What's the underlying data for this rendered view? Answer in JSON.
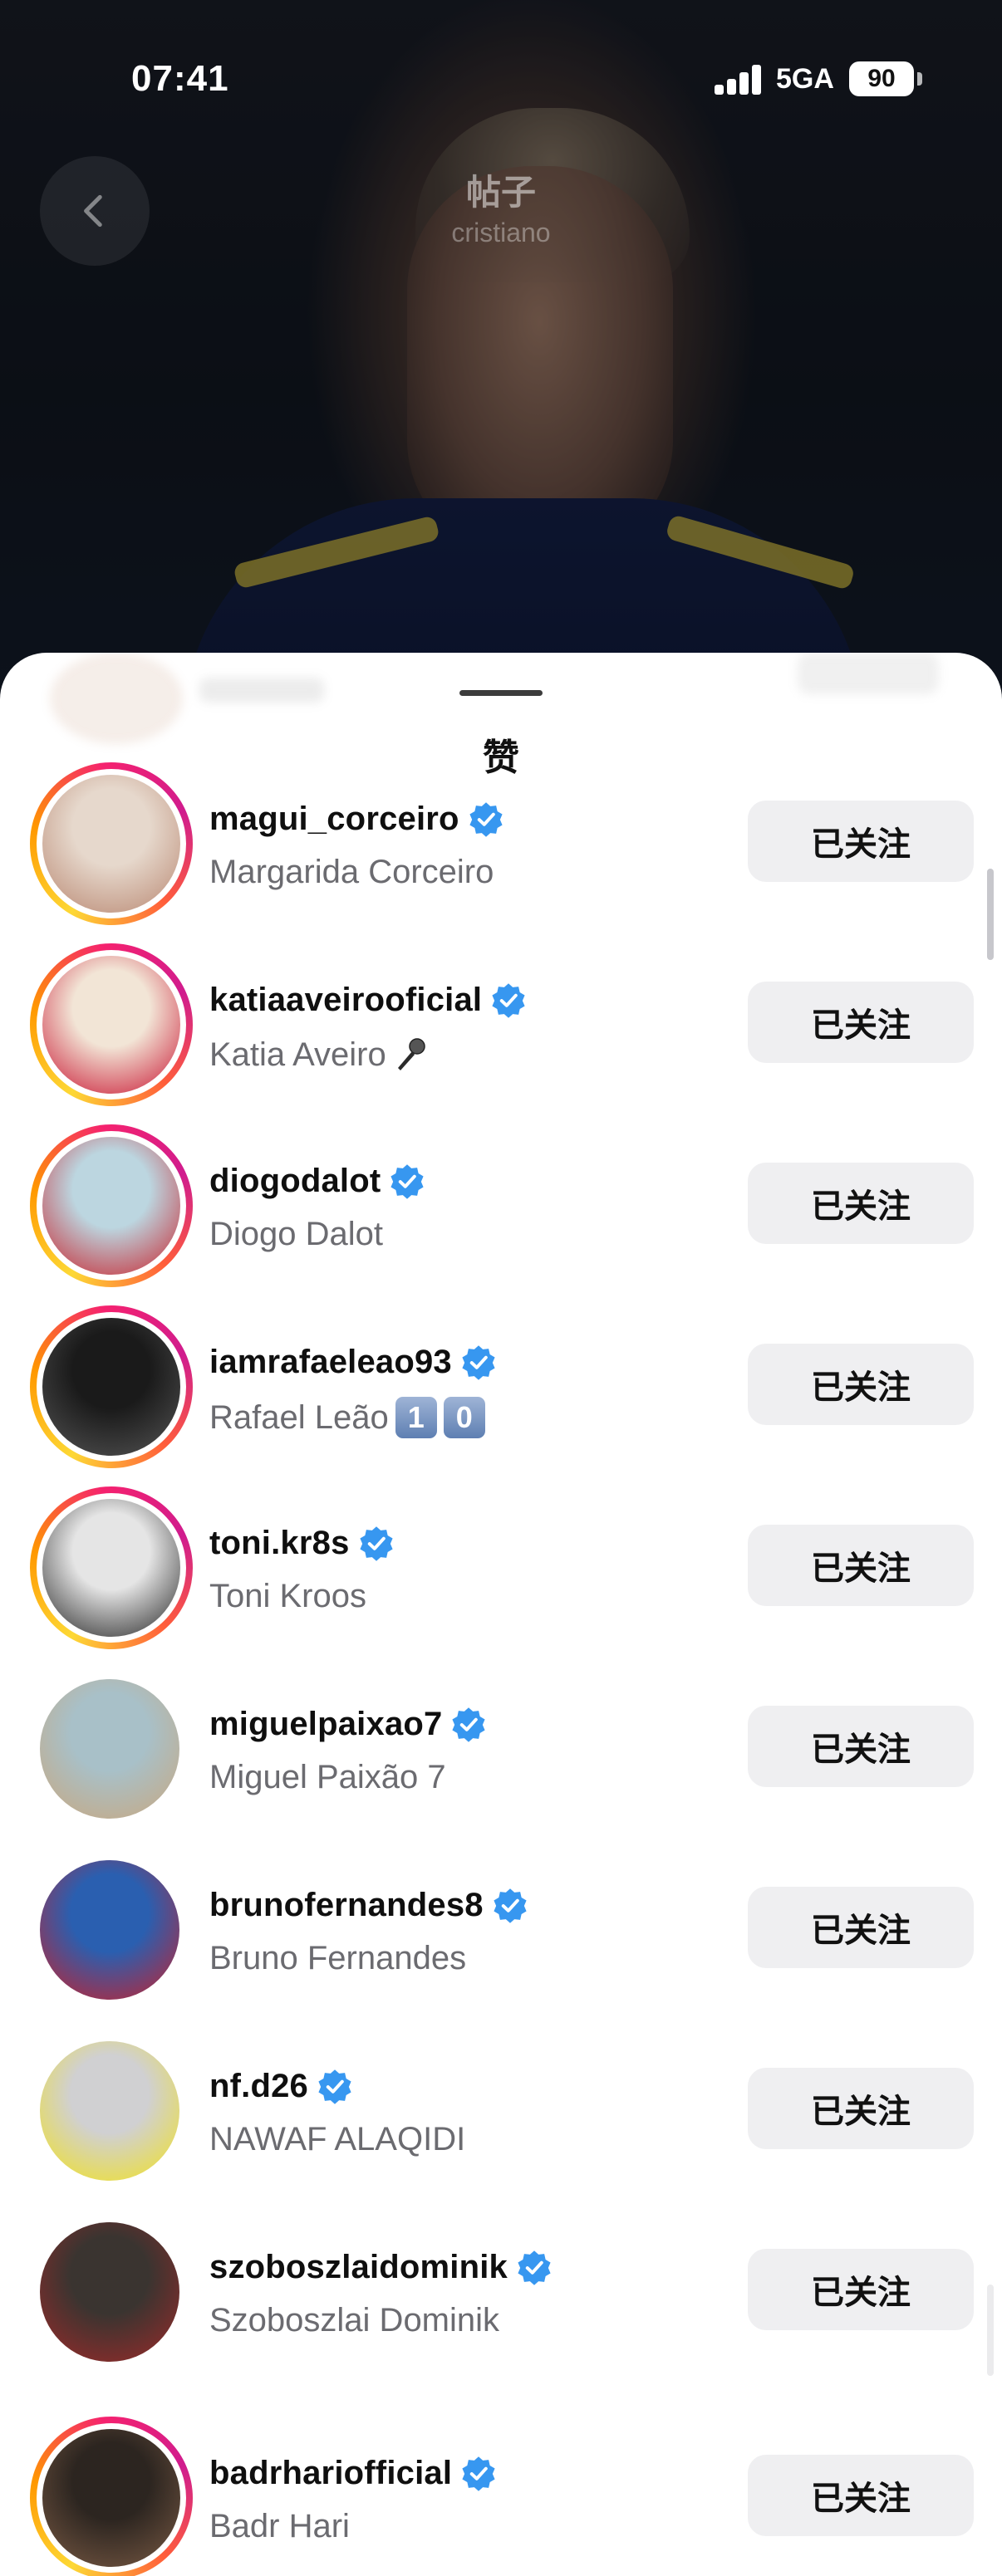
{
  "status_bar": {
    "time": "07:41",
    "network": "5GA",
    "battery": "90"
  },
  "header": {
    "title": "帖子",
    "subtitle": "cristiano"
  },
  "sheet": {
    "title": "赞"
  },
  "likes": [
    {
      "username": "magui_corceiro",
      "display_name": "Margarida Corceiro",
      "button": "已关注",
      "has_story": true,
      "avatar_colors": [
        "#e6d8cc",
        "#b88670"
      ]
    },
    {
      "username": "katiaaveirooficial",
      "display_name": "Katia Aveiro",
      "name_icon": "microphone-icon",
      "button": "已关注",
      "has_story": true,
      "avatar_colors": [
        "#f2e5d6",
        "#c8102e"
      ]
    },
    {
      "username": "diogodalot",
      "display_name": "Diogo Dalot",
      "button": "已关注",
      "has_story": true,
      "avatar_colors": [
        "#bcd6e0",
        "#c8202a"
      ]
    },
    {
      "username": "iamrafaeleao93",
      "display_name": "Rafael Leão",
      "name_keycaps": [
        "1",
        "0"
      ],
      "button": "已关注",
      "has_story": true,
      "avatar_colors": [
        "#1a1a1a",
        "#555555"
      ]
    },
    {
      "username": "toni.kr8s",
      "display_name": "Toni Kroos",
      "button": "已关注",
      "has_story": true,
      "avatar_colors": [
        "#e5e5e5",
        "#222222"
      ]
    },
    {
      "username": "miguelpaixao7",
      "display_name": "Miguel Paixão 7",
      "button": "已关注",
      "has_story": false,
      "avatar_colors": [
        "#a8c0c8",
        "#c9a77e"
      ]
    },
    {
      "username": "brunofernandes8",
      "display_name": "Bruno Fernandes",
      "button": "已关注",
      "has_story": false,
      "avatar_colors": [
        "#2a5fb0",
        "#c8202a"
      ]
    },
    {
      "username": "nf.d26",
      "display_name": "NAWAF ALAQIDI",
      "button": "已关注",
      "has_story": false,
      "avatar_colors": [
        "#d0d0d2",
        "#f2e21d"
      ]
    },
    {
      "username": "szoboszlaidominik",
      "display_name": "Szoboszlai Dominik",
      "button": "已关注",
      "has_story": false,
      "avatar_colors": [
        "#3a3430",
        "#9d2a2a"
      ]
    },
    {
      "username": "badrhariofficial",
      "display_name": "Badr  Hari",
      "button": "已关注",
      "has_story": true,
      "avatar_colors": [
        "#2c2520",
        "#7a5a44"
      ]
    }
  ],
  "colors": {
    "verified": "#3797f0",
    "button_bg": "#efeff1",
    "secondary_text": "#6b6b70"
  }
}
